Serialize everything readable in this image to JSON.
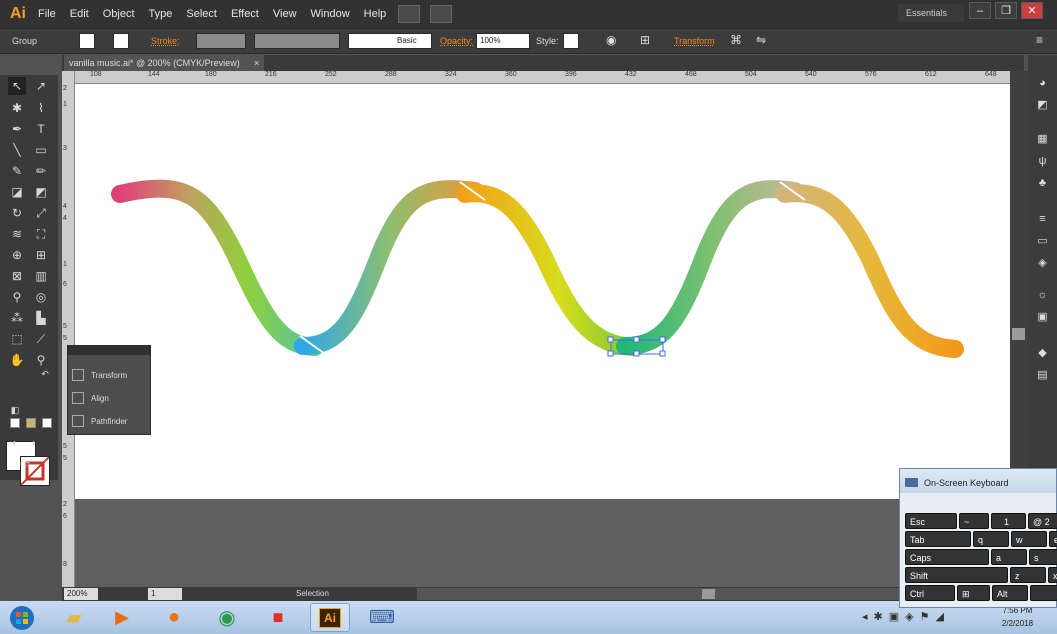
{
  "app": {
    "logo": "Ai",
    "workspace": "Essentials"
  },
  "menu": [
    "File",
    "Edit",
    "Object",
    "Type",
    "Select",
    "Effect",
    "View",
    "Window",
    "Help"
  ],
  "control_bar": {
    "selection_type": "Group",
    "stroke_label": "Stroke:",
    "brush": "Basic",
    "opacity_label": "Opacity:",
    "opacity_value": "100%",
    "style_label": "Style:",
    "transform_link": "Transform"
  },
  "document": {
    "tab_title": "vanilla music.ai* @ 200% (CMYK/Preview)"
  },
  "hruler_ticks": [
    "108",
    "144",
    "180",
    "216",
    "252",
    "288",
    "324",
    "360",
    "396",
    "432",
    "468",
    "504",
    "540",
    "576",
    "612",
    "648"
  ],
  "vruler_ticks": [
    "2",
    "1",
    "3",
    "4",
    "4",
    "1",
    "6",
    "5",
    "5",
    "5",
    "5",
    "2",
    "6",
    "8"
  ],
  "floating_panel": {
    "items": [
      "Transform",
      "Align",
      "Pathfinder"
    ]
  },
  "status_bar": {
    "zoom": "200%",
    "page": "1",
    "mode": "Selection"
  },
  "taskbar": {
    "time": "7:56 PM",
    "date": "2/2/2018"
  },
  "osk": {
    "title": "On-Screen Keyboard",
    "keys": {
      "esc": "Esc",
      "tilde": "~",
      "one": "1",
      "at": "@",
      "two": "2",
      "tab": "Tab",
      "q": "q",
      "w": "w",
      "e": "e",
      "caps": "Caps",
      "a": "a",
      "s": "s",
      "shift": "Shift",
      "z": "z",
      "x": "x",
      "ctrl": "Ctrl",
      "alt": "Alt"
    }
  },
  "colors": {
    "wave_gradient": [
      "#e0407a",
      "#f08a3a",
      "#8fcf3e",
      "#2fa8e8",
      "#c8a060",
      "#f2a21a",
      "#d8dc1c",
      "#22b87a",
      "#e6b83a",
      "#f29a1a"
    ]
  }
}
